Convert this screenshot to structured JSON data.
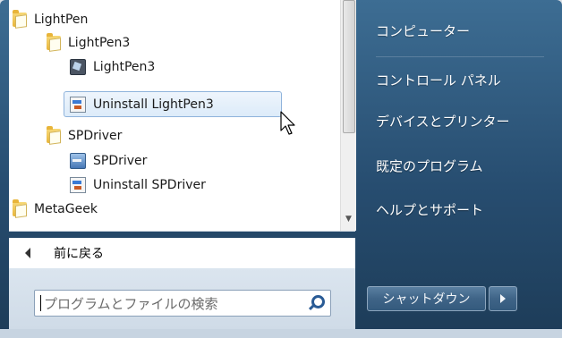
{
  "programs": [
    {
      "label": "LightPen",
      "icon": "folder-icon"
    },
    {
      "label": "LightPen3",
      "icon": "folder-icon"
    },
    {
      "label": "LightPen3",
      "icon": "app-icon"
    },
    {
      "label": "Uninstall LightPen3",
      "icon": "uninstall-icon",
      "selected": true
    },
    {
      "label": "SPDriver",
      "icon": "folder-icon"
    },
    {
      "label": "SPDriver",
      "icon": "driver-icon"
    },
    {
      "label": "Uninstall SPDriver",
      "icon": "uninstall-icon"
    },
    {
      "label": "MetaGeek",
      "icon": "folder-icon"
    }
  ],
  "back_label": "前に戻る",
  "search": {
    "placeholder": "プログラムとファイルの検索"
  },
  "right_panel": {
    "computer": "コンピューター",
    "control_panel": "コントロール パネル",
    "devices_printers": "デバイスとプリンター",
    "default_programs": "既定のプログラム",
    "help_support": "ヘルプとサポート"
  },
  "shutdown_label": "シャットダウン",
  "colors": {
    "selection_border": "#8fb3dc",
    "panel_bg": "#2a5377"
  }
}
